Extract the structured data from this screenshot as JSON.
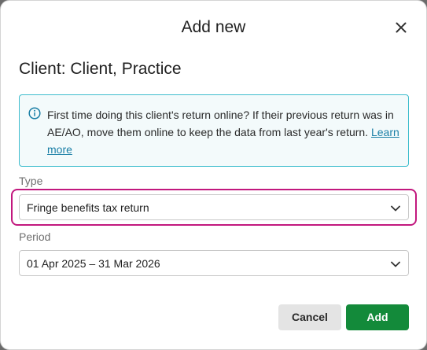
{
  "dialog": {
    "title": "Add new",
    "close_icon": "close-icon"
  },
  "client_heading": "Client: Client, Practice",
  "info": {
    "icon": "info-icon",
    "text": "First time doing this client's return online? If their previous return was in AE/AO, move them online to keep the data from last year's return.",
    "link_label": "Learn more",
    "accent": "#3ebdcd"
  },
  "type_field": {
    "label": "Type",
    "value": "Fringe benefits tax return",
    "icon": "chevron-down-icon",
    "highlight_color": "#c2187e"
  },
  "period_field": {
    "label": "Period",
    "value": "01 Apr 2025 – 31 Mar 2026",
    "icon": "chevron-down-icon"
  },
  "actions": {
    "cancel_label": "Cancel",
    "add_label": "Add",
    "add_color": "#138a3a"
  }
}
